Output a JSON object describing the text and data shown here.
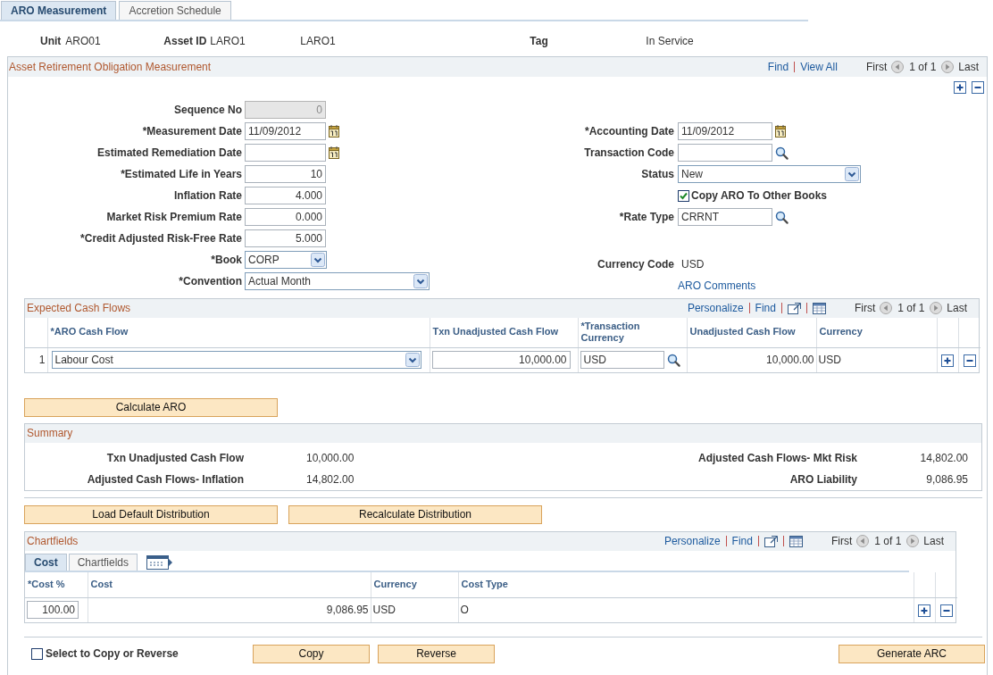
{
  "tabs": [
    {
      "label": "ARO Measurement",
      "selected": true
    },
    {
      "label": "Accretion Schedule",
      "selected": false
    }
  ],
  "header": {
    "unit_label": "Unit",
    "unit": "ARO01",
    "asset_id_label": "Asset ID",
    "asset_id": "LARO1",
    "asset_description": "LARO1",
    "tag_label": "Tag",
    "tag": "In Service"
  },
  "measurement": {
    "title": "Asset Retirement Obligation Measurement",
    "nav": {
      "kind": "scroll",
      "find": "Find",
      "view_all": "View All",
      "first": "First",
      "count": "1 of 1",
      "last": "Last"
    },
    "left_fields": [
      {
        "kind": "number",
        "label": "Sequence No",
        "value": "0",
        "disabled": true
      },
      {
        "kind": "date",
        "label": "*Measurement Date",
        "value": "11/09/2012",
        "disabled": false
      },
      {
        "kind": "date",
        "label": "Estimated Remediation Date",
        "disabled": false
      },
      {
        "kind": "number",
        "label": "*Estimated Life in Years",
        "value": "10",
        "disabled": false
      },
      {
        "kind": "number",
        "label": "Inflation Rate",
        "value": "4.000",
        "disabled": false
      },
      {
        "kind": "number",
        "label": "Market Risk Premium Rate",
        "value": "0.000",
        "disabled": false
      },
      {
        "kind": "number",
        "label": "*Credit Adjusted Risk-Free Rate",
        "value": "5.000",
        "disabled": false
      },
      {
        "kind": "select",
        "label": "*Book",
        "value": "CORP",
        "disabled": false
      },
      {
        "kind": "select",
        "label": "*Convention",
        "value": "Actual Month",
        "disabled": false
      }
    ],
    "right_fields": [
      {
        "kind": "date",
        "label": "*Accounting Date",
        "value": "11/09/2012"
      },
      {
        "kind": "lookup",
        "label": "Transaction Code"
      },
      {
        "kind": "select",
        "label": "Status",
        "value": "New"
      },
      {
        "kind": "checkbox",
        "label": "Copy ARO To Other Books",
        "checked": true
      },
      {
        "kind": "lookup",
        "label": "*Rate Type",
        "value": "CRRNT"
      },
      {
        "kind": "display",
        "label": "Currency Code",
        "value": "USD"
      },
      {
        "kind": "link",
        "label": "ARO Comments"
      }
    ]
  },
  "cash_flows": {
    "title": "Expected Cash Flows",
    "nav": {
      "kind": "grid",
      "personalize": "Personalize",
      "find": "Find",
      "first": "First",
      "count": "1 of 1",
      "last": "Last"
    },
    "columns": [
      "*ARO Cash Flow",
      "Txn Unadjusted Cash Flow",
      "*Transaction Currency",
      "Unadjusted Cash Flow",
      "Currency"
    ],
    "rows": [
      {
        "number": "1",
        "aro_cash_flow": "Labour Cost",
        "txn_unadjusted_cash_flow": "10,000.00",
        "transaction_currency": "USD",
        "unadjusted_cash_flow": "10,000.00",
        "currency": "USD"
      }
    ]
  },
  "calculate_button": "Calculate ARO",
  "summary": {
    "title": "Summary",
    "items": [
      {
        "label": "Txn Unadjusted Cash Flow",
        "value": "10,000.00"
      },
      {
        "label": "Adjusted Cash Flows- Mkt Risk",
        "value": "14,802.00"
      },
      {
        "label": "Adjusted Cash Flows- Inflation",
        "value": "14,802.00"
      },
      {
        "label": "ARO Liability",
        "value": "9,086.95"
      }
    ]
  },
  "distribution_buttons": [
    "Load Default Distribution",
    "Recalculate Distribution"
  ],
  "chartfields": {
    "title": "Chartfields",
    "nav": {
      "kind": "grid",
      "personalize": "Personalize",
      "find": "Find",
      "first": "First",
      "count": "1 of 1",
      "last": "Last"
    },
    "tabs": [
      {
        "label": "Cost",
        "selected": true
      },
      {
        "label": "Chartfields",
        "selected": false
      }
    ],
    "columns": [
      "*Cost %",
      "Cost",
      "Currency",
      "Cost Type"
    ],
    "rows": [
      {
        "cost_percent": "100.00",
        "cost": "9,086.95",
        "currency": "USD",
        "cost_type": "O"
      }
    ]
  },
  "footer": {
    "select_checkbox": {
      "label": "Select to Copy or Reverse",
      "checked": false
    },
    "buttons": [
      "Copy",
      "Reverse",
      "Generate ARC"
    ]
  }
}
